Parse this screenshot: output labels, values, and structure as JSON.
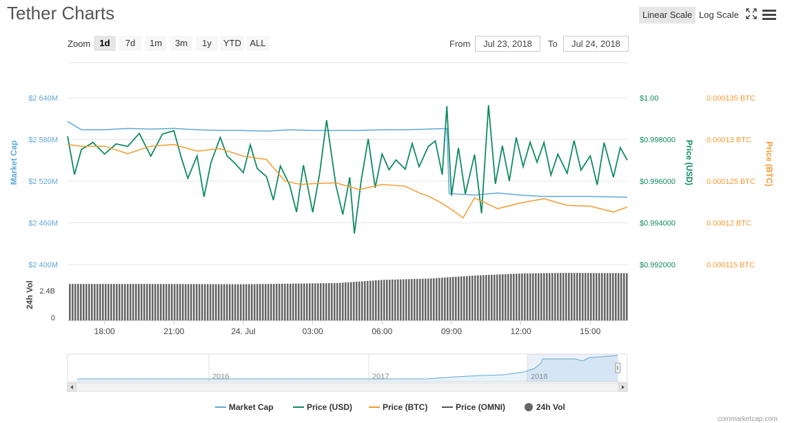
{
  "header": {
    "title": "Tether Charts",
    "linear_scale": "Linear Scale",
    "log_scale": "Log Scale",
    "active_scale": "linear",
    "fullscreen_icon": "fullscreen-icon",
    "menu_icon": "hamburger-menu-icon"
  },
  "zoom": {
    "label": "Zoom",
    "options": [
      "1d",
      "7d",
      "1m",
      "3m",
      "1y",
      "YTD",
      "ALL"
    ],
    "selected": "1d"
  },
  "range": {
    "from_label": "From",
    "from_value": "Jul 23, 2018",
    "to_label": "To",
    "to_value": "Jul 24, 2018"
  },
  "colors": {
    "market_cap": "#5fa8d8",
    "price_usd": "#0e8a5f",
    "price_btc": "#f39a2e",
    "price_omni": "#555555",
    "vol": "#666666",
    "grid": "#e6e6e6"
  },
  "chart_data": {
    "type": "line",
    "x_ticks": [
      "18:00",
      "21:00",
      "24. Jul",
      "03:00",
      "06:00",
      "09:00",
      "12:00",
      "15:00"
    ],
    "x_range_hours": [
      16.4,
      40.6
    ],
    "axes": {
      "market_cap": {
        "label": "Market Cap",
        "ticks": [
          "$2 640M",
          "$2 580M",
          "$2 520M",
          "$2 460M",
          "$2 400M"
        ],
        "range": [
          2400,
          2640
        ]
      },
      "price_usd": {
        "label": "Price (USD)",
        "ticks": [
          "$1.00",
          "$0.998000",
          "$0.996000",
          "$0.994000",
          "$0.992000"
        ],
        "range": [
          0.992,
          1.0
        ]
      },
      "price_btc": {
        "label": "Price (BTC)",
        "ticks": [
          "0.000135 BTC",
          "0.00013 BTC",
          "0.000125 BTC",
          "0.00012 BTC",
          "0.000115 BTC"
        ],
        "range": [
          0.000115,
          0.000135
        ]
      },
      "vol": {
        "label": "24h Vol",
        "ticks": [
          "2.4B",
          "0"
        ],
        "range": [
          0,
          3.5
        ]
      }
    },
    "series": [
      {
        "name": "Market Cap",
        "axis": "market_cap",
        "points": [
          [
            16.4,
            2606
          ],
          [
            17.0,
            2594
          ],
          [
            18.0,
            2594
          ],
          [
            19.0,
            2596
          ],
          [
            20.0,
            2595
          ],
          [
            21.0,
            2596
          ],
          [
            22.0,
            2594
          ],
          [
            23.0,
            2593
          ],
          [
            24.0,
            2593
          ],
          [
            25.0,
            2592
          ],
          [
            26.0,
            2594
          ],
          [
            27.0,
            2593
          ],
          [
            28.0,
            2593
          ],
          [
            29.0,
            2593
          ],
          [
            30.0,
            2594
          ],
          [
            31.0,
            2594
          ],
          [
            32.0,
            2595
          ],
          [
            32.8,
            2596
          ],
          [
            32.9,
            2502
          ],
          [
            34.0,
            2500
          ],
          [
            35.0,
            2503
          ],
          [
            36.0,
            2500
          ],
          [
            37.0,
            2498
          ],
          [
            38.0,
            2498
          ],
          [
            39.0,
            2498
          ],
          [
            40.6,
            2497
          ]
        ]
      },
      {
        "name": "Price (USD)",
        "axis": "price_usd",
        "points": [
          [
            16.4,
            0.99816
          ],
          [
            16.7,
            0.99632
          ],
          [
            17.0,
            0.99752
          ],
          [
            17.5,
            0.99786
          ],
          [
            18.0,
            0.9973
          ],
          [
            18.5,
            0.99779
          ],
          [
            19.0,
            0.99767
          ],
          [
            19.5,
            0.99829
          ],
          [
            20.0,
            0.9972
          ],
          [
            20.5,
            0.99826
          ],
          [
            21.0,
            0.99842
          ],
          [
            21.3,
            0.9972
          ],
          [
            21.6,
            0.99614
          ],
          [
            22.0,
            0.99721
          ],
          [
            22.3,
            0.99525
          ],
          [
            22.6,
            0.99688
          ],
          [
            23.0,
            0.9981
          ],
          [
            23.3,
            0.99721
          ],
          [
            23.6,
            0.9969
          ],
          [
            24.0,
            0.99641
          ],
          [
            24.3,
            0.99775
          ],
          [
            24.6,
            0.99661
          ],
          [
            25.0,
            0.99622
          ],
          [
            25.3,
            0.99509
          ],
          [
            25.6,
            0.99673
          ],
          [
            26.0,
            0.99583
          ],
          [
            26.3,
            0.99452
          ],
          [
            26.6,
            0.99677
          ],
          [
            27.0,
            0.99451
          ],
          [
            27.3,
            0.99636
          ],
          [
            27.6,
            0.99893
          ],
          [
            28.0,
            0.99582
          ],
          [
            28.3,
            0.9944
          ],
          [
            28.6,
            0.99619
          ],
          [
            28.8,
            0.99349
          ],
          [
            29.1,
            0.99605
          ],
          [
            29.4,
            0.99803
          ],
          [
            29.7,
            0.99569
          ],
          [
            30.0,
            0.99731
          ],
          [
            30.3,
            0.99655
          ],
          [
            30.6,
            0.99702
          ],
          [
            31.0,
            0.99658
          ],
          [
            31.3,
            0.99781
          ],
          [
            31.6,
            0.99669
          ],
          [
            32.0,
            0.99767
          ],
          [
            32.3,
            0.99793
          ],
          [
            32.6,
            0.99631
          ],
          [
            32.8,
            0.9996
          ],
          [
            33.0,
            0.99531
          ],
          [
            33.3,
            0.9976
          ],
          [
            33.6,
            0.99539
          ],
          [
            34.0,
            0.99728
          ],
          [
            34.3,
            0.99446
          ],
          [
            34.6,
            0.99965
          ],
          [
            34.9,
            0.99587
          ],
          [
            35.2,
            0.9977
          ],
          [
            35.5,
            0.99601
          ],
          [
            35.8,
            0.9981
          ],
          [
            36.1,
            0.9967
          ],
          [
            36.4,
            0.99787
          ],
          [
            36.7,
            0.99691
          ],
          [
            37.0,
            0.99786
          ],
          [
            37.3,
            0.99629
          ],
          [
            37.6,
            0.9973
          ],
          [
            38.0,
            0.99638
          ],
          [
            38.3,
            0.99795
          ],
          [
            38.6,
            0.99653
          ],
          [
            39.0,
            0.99722
          ],
          [
            39.3,
            0.99582
          ],
          [
            39.6,
            0.99785
          ],
          [
            40.0,
            0.99619
          ],
          [
            40.3,
            0.99761
          ],
          [
            40.6,
            0.99701
          ]
        ]
      },
      {
        "name": "Price (BTC)",
        "axis": "price_btc",
        "points": [
          [
            16.4,
            0.0001294
          ],
          [
            17.0,
            0.0001292
          ],
          [
            18.0,
            0.0001292
          ],
          [
            19.0,
            0.0001283
          ],
          [
            20.0,
            0.0001292
          ],
          [
            21.0,
            0.0001294
          ],
          [
            22.0,
            0.0001286
          ],
          [
            23.0,
            0.0001289
          ],
          [
            24.0,
            0.000128
          ],
          [
            25.0,
            0.0001276
          ],
          [
            25.8,
            0.000125
          ],
          [
            26.5,
            0.0001246
          ],
          [
            27.0,
            0.0001247
          ],
          [
            28.0,
            0.0001248
          ],
          [
            29.0,
            0.000124
          ],
          [
            30.0,
            0.0001246
          ],
          [
            31.0,
            0.0001244
          ],
          [
            31.6,
            0.0001236
          ],
          [
            32.0,
            0.0001232
          ],
          [
            32.5,
            0.0001225
          ],
          [
            33.0,
            0.0001216
          ],
          [
            33.5,
            0.0001206
          ],
          [
            34.0,
            0.000123
          ],
          [
            35.0,
            0.0001217
          ],
          [
            36.0,
            0.0001224
          ],
          [
            37.0,
            0.0001229
          ],
          [
            38.0,
            0.0001221
          ],
          [
            39.0,
            0.000122
          ],
          [
            40.0,
            0.0001213
          ],
          [
            40.6,
            0.0001219
          ]
        ]
      },
      {
        "name": "24h Vol",
        "axis": "vol",
        "type": "bar",
        "points": [
          [
            16.4,
            2.5
          ],
          [
            20.0,
            2.5
          ],
          [
            24.0,
            2.48
          ],
          [
            28.0,
            2.56
          ],
          [
            30.0,
            2.78
          ],
          [
            32.0,
            2.87
          ],
          [
            34.0,
            3.08
          ],
          [
            36.0,
            3.22
          ],
          [
            38.0,
            3.26
          ],
          [
            40.6,
            3.24
          ]
        ]
      }
    ],
    "legend": [
      "Market Cap",
      "Price (USD)",
      "Price (BTC)",
      "Price (OMNI)",
      "24h Vol"
    ],
    "legend_placement": "bottom",
    "navigator": {
      "x_labels": [
        "2016",
        "2017",
        "2018"
      ]
    },
    "credit": "coinmarketcap.com"
  }
}
